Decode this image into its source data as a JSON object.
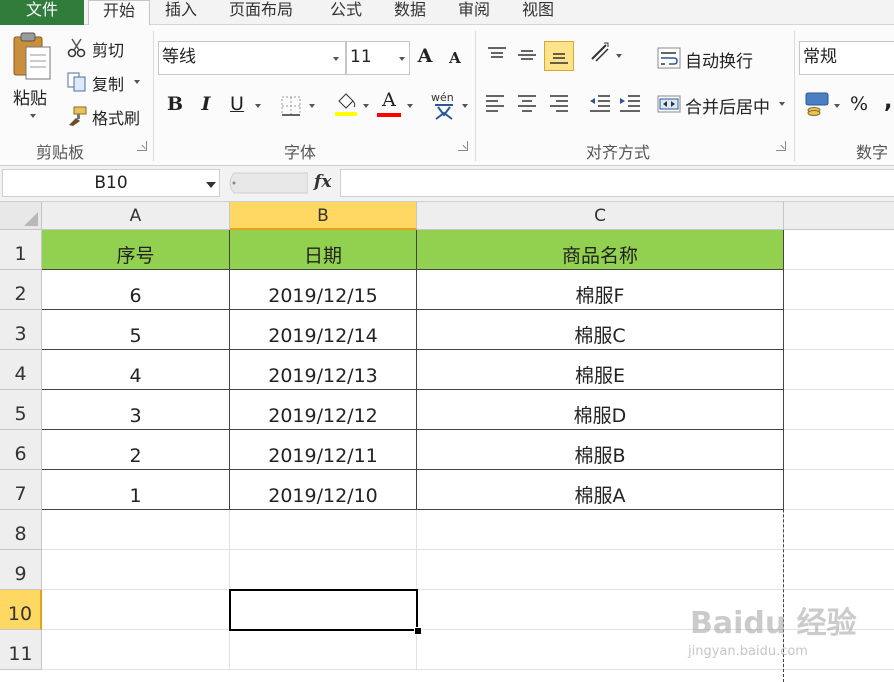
{
  "tabs": {
    "file": "文件",
    "items": [
      "开始",
      "插入",
      "页面布局",
      "公式",
      "数据",
      "审阅",
      "视图"
    ]
  },
  "ribbon": {
    "clipboard": {
      "paste": "粘贴",
      "cut": "剪切",
      "copy": "复制",
      "format_painter": "格式刷",
      "group_label": "剪贴板"
    },
    "font": {
      "font_name": "等线",
      "font_size": "11",
      "grow": "A",
      "shrink": "A",
      "bold": "B",
      "italic": "I",
      "underline": "U",
      "font_color": "A",
      "phonetic": "wén",
      "group_label": "字体",
      "fill_color": "#ffff00",
      "text_color": "#ff0000"
    },
    "alignment": {
      "wrap_text": "自动换行",
      "merge_center": "合并后居中",
      "group_label": "对齐方式"
    },
    "number": {
      "format": "常规",
      "percent": "%",
      "comma": ",",
      "group_label": "数字"
    }
  },
  "formula_bar": {
    "name_box": "B10",
    "fx": "fx",
    "content": ""
  },
  "sheet": {
    "columns": [
      "A",
      "B",
      "C"
    ],
    "rows": [
      "1",
      "2",
      "3",
      "4",
      "5",
      "6",
      "7",
      "8",
      "9",
      "10",
      "11"
    ],
    "header": [
      "序号",
      "日期",
      "商品名称"
    ],
    "data": [
      [
        "6",
        "2019/12/15",
        "棉服F"
      ],
      [
        "5",
        "2019/12/14",
        "棉服C"
      ],
      [
        "4",
        "2019/12/13",
        "棉服E"
      ],
      [
        "3",
        "2019/12/12",
        "棉服D"
      ],
      [
        "2",
        "2019/12/11",
        "棉服B"
      ],
      [
        "1",
        "2019/12/10",
        "棉服A"
      ]
    ],
    "selected_cell": "B10",
    "header_fill": "#92d050"
  },
  "watermark": {
    "logo": "Baidu 经验",
    "url": "jingyan.baidu.com"
  }
}
